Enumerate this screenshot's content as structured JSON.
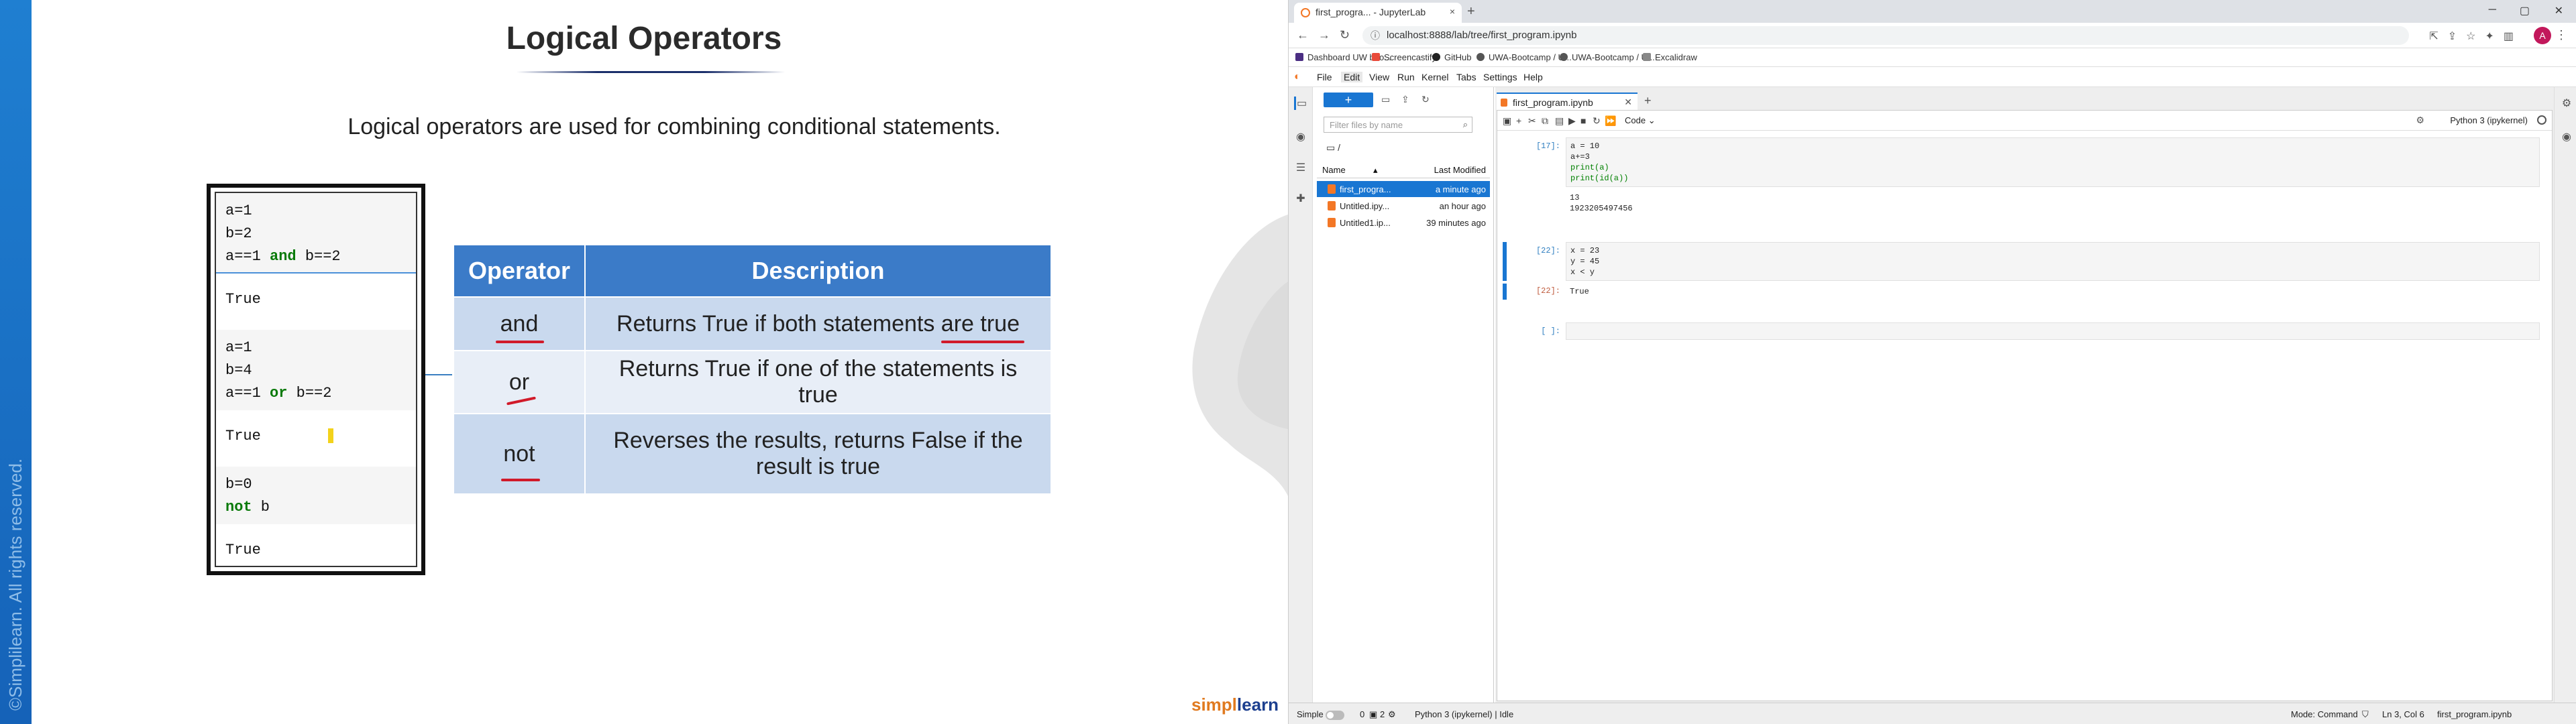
{
  "slide": {
    "copyright": "©Simplilearn. All rights reserved.",
    "title": "Logical Operators",
    "subtitle": "Logical operators are used for combining conditional statements.",
    "code_cells": [
      {
        "kind": "in",
        "lines": [
          [
            "a=1"
          ],
          [
            "b=2"
          ],
          [
            "a==1 ",
            "and",
            " b==2"
          ]
        ]
      },
      {
        "kind": "out",
        "text": "True"
      },
      {
        "kind": "in",
        "lines": [
          [
            "a=1"
          ],
          [
            "b=4"
          ],
          [
            "a==1 ",
            "or",
            " b==2"
          ]
        ]
      },
      {
        "kind": "out",
        "text": "True"
      },
      {
        "kind": "in",
        "lines": [
          [
            "b=0"
          ],
          [
            "",
            "not",
            " b"
          ]
        ]
      },
      {
        "kind": "out",
        "text": "True"
      }
    ],
    "table": {
      "headers": [
        "Operator",
        "Description"
      ],
      "rows": [
        {
          "op": "and",
          "desc": "Returns True if both statements are true"
        },
        {
          "op": "or",
          "desc": "Returns True if one of the statements is true"
        },
        {
          "op": "not",
          "desc": "Reverses the results, returns False if the result is true"
        }
      ]
    },
    "logo_a": "simpl",
    "logo_b": "learn"
  },
  "browser": {
    "tab_title": "first_progra... - JupyterLab",
    "tab_close": "×",
    "new_tab": "+",
    "url": "localhost:8888/lab/tree/first_program.ipynb",
    "bookmarks": [
      "Dashboard UW boo...",
      "Screencastify",
      "GitHub",
      "UWA-Bootcamp / U...",
      "UWA-Bootcamp / U...",
      "Excalidraw"
    ],
    "profile_initial": "A"
  },
  "jupyter": {
    "menus": [
      "File",
      "Edit",
      "View",
      "Run",
      "Kernel",
      "Tabs",
      "Settings",
      "Help"
    ],
    "active_menu": "Edit",
    "filebrowser": {
      "new_label": "+",
      "filter_placeholder": "Filter files by name",
      "path": "/",
      "col_name": "Name",
      "col_modified": "Last Modified",
      "files": [
        {
          "name": "first_progra...",
          "modified": "a minute ago",
          "selected": true
        },
        {
          "name": "Untitled.ipy...",
          "modified": "an hour ago",
          "selected": false
        },
        {
          "name": "Untitled1.ip...",
          "modified": "39 minutes ago",
          "selected": false
        }
      ]
    },
    "doc_tab": "first_program.ipynb",
    "cell_type": "Code",
    "kernel": "Python 3 (ipykernel)",
    "cells": [
      {
        "prompt": "[17]:",
        "code": [
          "a = 10",
          "a+=3",
          "print(a)",
          "print(id(a))"
        ],
        "output": [
          "13",
          "1923205497456"
        ],
        "output_prompt": ""
      },
      {
        "prompt": "[22]:",
        "code": [
          "x = 23",
          "y = 45",
          "x < y"
        ],
        "output": [
          "True"
        ],
        "output_prompt": "[22]:"
      },
      {
        "prompt": "[ ]:",
        "code": [
          ""
        ],
        "output": [],
        "output_prompt": ""
      }
    ],
    "status": {
      "mode_label": "Simple",
      "count_a": "0",
      "count_b": "2",
      "kernel_status": "Python 3 (ipykernel) | Idle",
      "mode": "Mode: Command",
      "cursor": "Ln 3, Col 6",
      "file": "first_program.ipynb"
    }
  }
}
